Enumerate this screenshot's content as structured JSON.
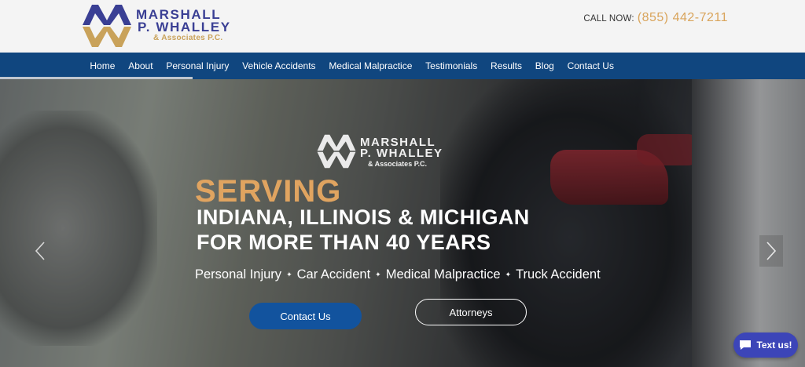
{
  "header": {
    "logo": {
      "line1": "MARSHALL",
      "line2": "P. WHALLEY",
      "line3": "& Associates P.C."
    },
    "call_label": "CALL NOW:",
    "call_number": "(855) 442-7211"
  },
  "nav": {
    "items": [
      {
        "label": "Home"
      },
      {
        "label": "About"
      },
      {
        "label": "Personal Injury"
      },
      {
        "label": "Vehicle Accidents"
      },
      {
        "label": "Medical Malpractice"
      },
      {
        "label": "Testimonials"
      },
      {
        "label": "Results"
      },
      {
        "label": "Blog"
      },
      {
        "label": "Contact Us"
      }
    ]
  },
  "hero": {
    "logo": {
      "line1": "MARSHALL",
      "line2": "P. WHALLEY",
      "line3": "& Associates P.C."
    },
    "serving": "SERVING",
    "headline1": "INDIANA, ILLINOIS & MICHIGAN",
    "headline2": "FOR MORE THAN 40 YEARS",
    "services": [
      "Personal Injury",
      "Car Accident",
      "Medical Malpractice",
      "Truck Accident"
    ],
    "separator": "✦",
    "contact_button": "Contact Us",
    "attorneys_button": "Attorneys",
    "prev_icon": "chevron-left-icon",
    "next_icon": "chevron-right-icon"
  },
  "chat": {
    "label": "Text us!",
    "icon": "chat-bubble-icon"
  },
  "colors": {
    "brand_blue": "#10467f",
    "brand_gold": "#d9a45b",
    "logo_blue": "#3a3f94",
    "button_blue": "#12539e",
    "chat_blue": "#3c45b8"
  }
}
